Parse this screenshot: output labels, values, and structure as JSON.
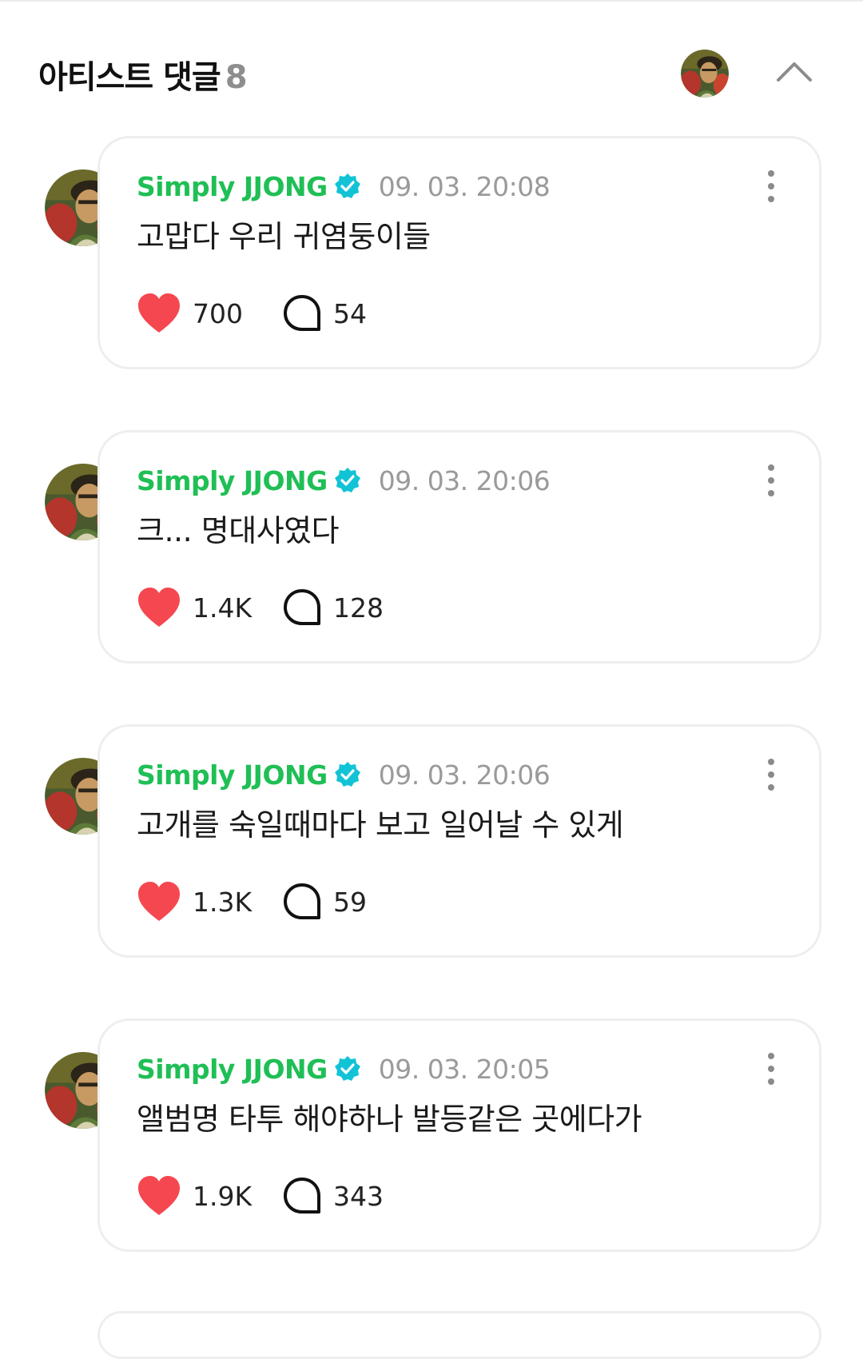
{
  "header": {
    "title": "아티스트 댓글",
    "count": "8"
  },
  "colors": {
    "author": "#1fbf55",
    "verified": "#12c3d6",
    "heart": "#f5474f",
    "timestamp": "#9a9a9a"
  },
  "icons": {
    "verified": "verified-badge-icon",
    "like": "heart-icon",
    "reply": "speech-bubble-icon",
    "more": "more-vertical-icon",
    "collapse": "chevron-up-icon"
  },
  "comments": [
    {
      "author": "Simply JJONG",
      "time": "09. 03. 20:08",
      "text": "고맙다 우리 귀염둥이들",
      "likes": "700",
      "replies": "54"
    },
    {
      "author": "Simply JJONG",
      "time": "09. 03. 20:06",
      "text": "크... 명대사였다",
      "likes": "1.4K",
      "replies": "128"
    },
    {
      "author": "Simply JJONG",
      "time": "09. 03. 20:06",
      "text": "고개를 숙일때마다 보고 일어날 수 있게",
      "likes": "1.3K",
      "replies": "59"
    },
    {
      "author": "Simply JJONG",
      "time": "09. 03. 20:05",
      "text": "앨범명 타투 해야하나 발등같은 곳에다가",
      "likes": "1.9K",
      "replies": "343"
    }
  ]
}
